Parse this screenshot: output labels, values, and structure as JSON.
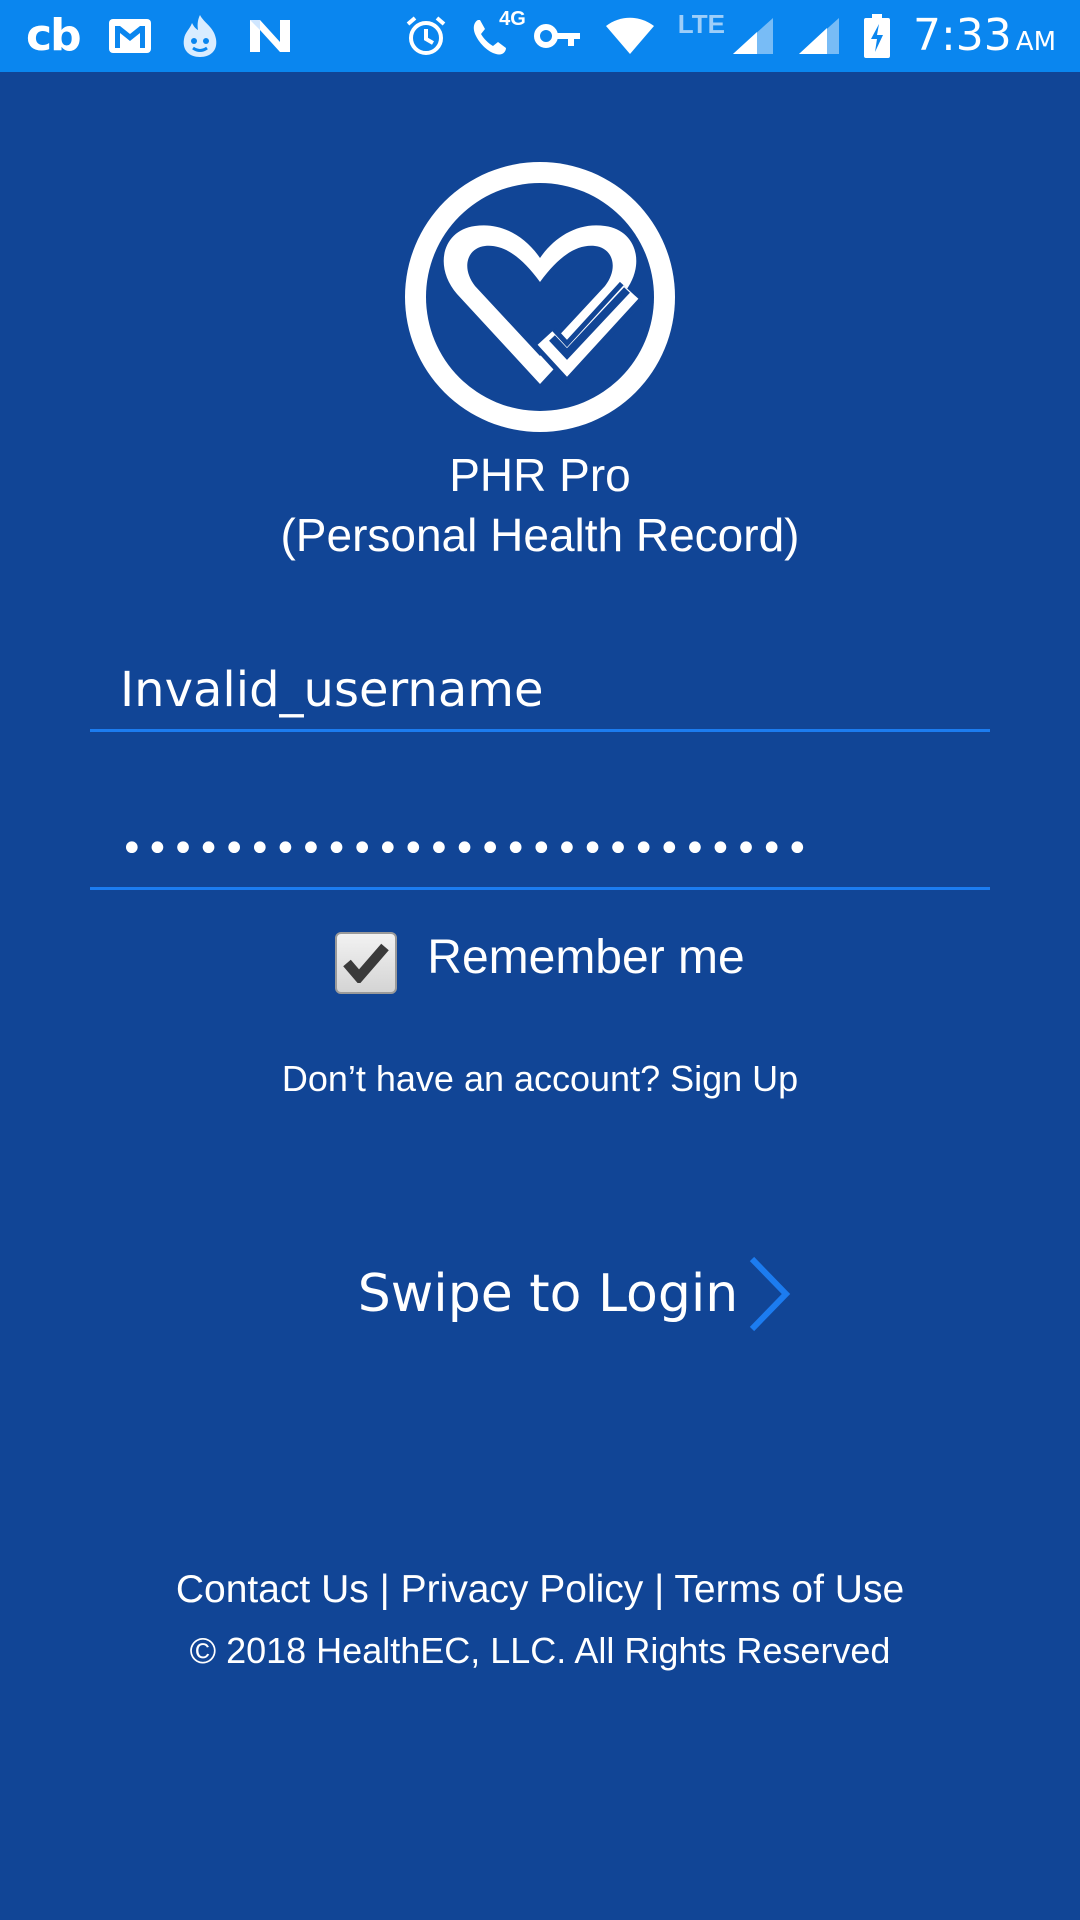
{
  "status_bar": {
    "left_icons": [
      "cb-icon",
      "gmail-icon",
      "flame-face-icon",
      "n-icon"
    ],
    "cb_label": "cb",
    "network_label": "LTE",
    "call_label": "4G",
    "time": "7:33",
    "ampm": "AM"
  },
  "app": {
    "title": "PHR Pro",
    "subtitle": "(Personal Health Record)"
  },
  "login_form": {
    "username_value": "Invalid_username",
    "password_value": "•••••••••••••••••••••••••••",
    "remember_label": "Remember me",
    "remember_checked": true,
    "signup_text": "Don’t have an account? Sign Up",
    "swipe_label": "Swipe to Login"
  },
  "footer": {
    "contact": "Contact Us",
    "separator": "|",
    "privacy": "Privacy Policy",
    "terms": "Terms of Use",
    "copyright": "© 2018 HealthEC, LLC. All Rights Reserved"
  },
  "colors": {
    "background": "#114596",
    "status_bar": "#0a86ef",
    "accent": "#1c7cf0"
  }
}
